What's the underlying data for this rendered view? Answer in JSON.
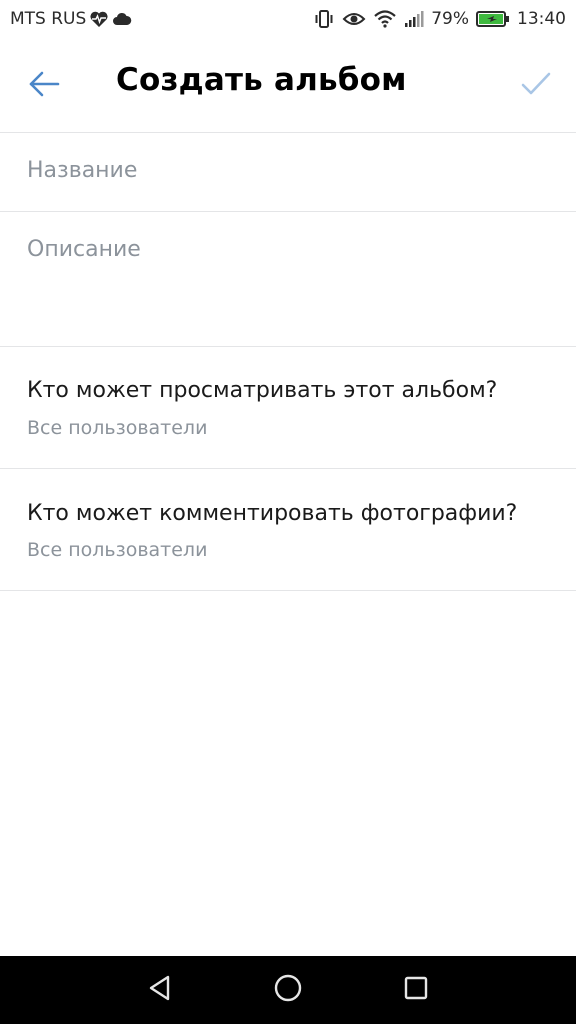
{
  "status_bar": {
    "carrier": "MTS RUS",
    "battery_percent": "79%",
    "time": "13:40"
  },
  "toolbar": {
    "title": "Создать альбом"
  },
  "form": {
    "name_placeholder": "Название",
    "description_placeholder": "Описание"
  },
  "settings": [
    {
      "title": "Кто может просматривать этот альбом?",
      "value": "Все пользователи"
    },
    {
      "title": "Кто может комментировать фотографии?",
      "value": "Все пользователи"
    }
  ],
  "colors": {
    "accent": "#4a86c8",
    "done_inactive": "#a9c6e6",
    "divider": "#e4e5e7",
    "secondary_text": "#8c939b"
  },
  "icons": {
    "back": "arrow-left-icon",
    "done": "check-icon",
    "nav_back": "triangle-back-icon",
    "nav_home": "circle-home-icon",
    "nav_recents": "square-recents-icon"
  }
}
